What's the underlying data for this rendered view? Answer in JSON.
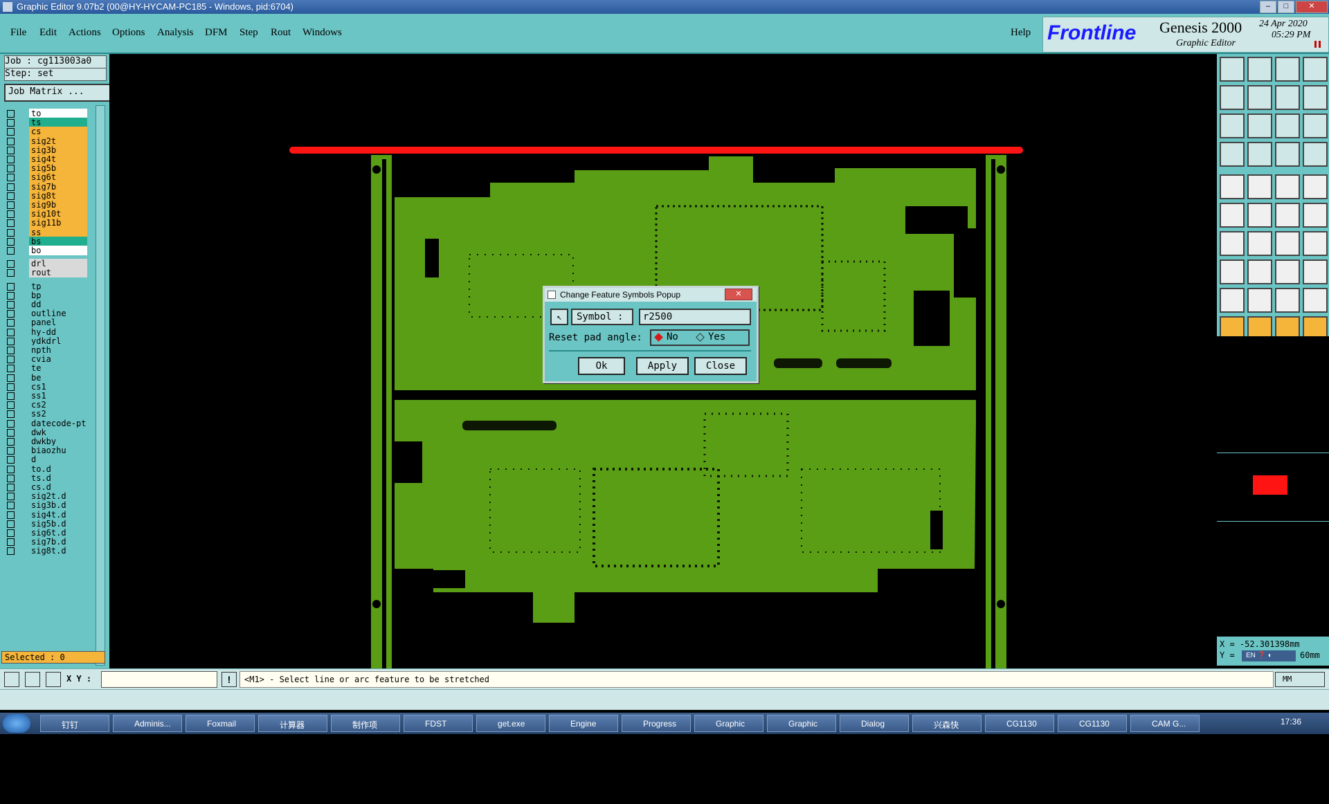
{
  "window": {
    "title": "Graphic Editor 9.07b2 (00@HY-HYCAM-PC185 - Windows, pid:6704)"
  },
  "menu": {
    "items": [
      "File",
      "Edit",
      "Actions",
      "Options",
      "Analysis",
      "DFM",
      "Step",
      "Rout",
      "Windows"
    ],
    "help": "Help"
  },
  "brand": {
    "logo": "Frontline",
    "product": "Genesis 2000",
    "subtitle": "Graphic Editor",
    "date": "24 Apr 2020",
    "time": "05:29 PM"
  },
  "job": {
    "job_label": "Job : cg113003a0",
    "step_label": "Step: set",
    "matrix_button": "Job Matrix ..."
  },
  "layers": [
    {
      "name": "to",
      "color": "#ffffff"
    },
    {
      "name": "ts",
      "color": "#1fae8e"
    },
    {
      "name": "cs",
      "color": "#f5b43a"
    },
    {
      "name": "sig2t",
      "color": "#f5b43a"
    },
    {
      "name": "sig3b",
      "color": "#f5b43a"
    },
    {
      "name": "sig4t",
      "color": "#f5b43a"
    },
    {
      "name": "sig5b",
      "color": "#f5b43a"
    },
    {
      "name": "sig6t",
      "color": "#f5b43a"
    },
    {
      "name": "sig7b",
      "color": "#f5b43a"
    },
    {
      "name": "sig8t",
      "color": "#f5b43a"
    },
    {
      "name": "sig9b",
      "color": "#f5b43a"
    },
    {
      "name": "sig10t",
      "color": "#f5b43a"
    },
    {
      "name": "sig11b",
      "color": "#f5b43a"
    },
    {
      "name": "ss",
      "color": "#f5b43a"
    },
    {
      "name": "bs",
      "color": "#1fae8e"
    },
    {
      "name": "bo",
      "color": "#ffffff"
    },
    {
      "name": "drl",
      "color": "#d9d9d9"
    },
    {
      "name": "rout",
      "color": "#d9d9d9"
    },
    {
      "name": "tp",
      "color": "#6cc5c5"
    },
    {
      "name": "bp",
      "color": "#6cc5c5"
    },
    {
      "name": "dd",
      "color": "#6cc5c5"
    },
    {
      "name": "outline",
      "color": "#6cc5c5"
    },
    {
      "name": "panel",
      "color": "#6cc5c5"
    },
    {
      "name": "hy-dd",
      "color": "#6cc5c5"
    },
    {
      "name": "ydkdrl",
      "color": "#6cc5c5"
    },
    {
      "name": "npth",
      "color": "#6cc5c5"
    },
    {
      "name": "cvia",
      "color": "#6cc5c5"
    },
    {
      "name": "te",
      "color": "#6cc5c5"
    },
    {
      "name": "be",
      "color": "#6cc5c5"
    },
    {
      "name": "cs1",
      "color": "#6cc5c5"
    },
    {
      "name": "ss1",
      "color": "#6cc5c5"
    },
    {
      "name": "cs2",
      "color": "#6cc5c5"
    },
    {
      "name": "ss2",
      "color": "#6cc5c5"
    },
    {
      "name": "datecode-pt",
      "color": "#6cc5c5"
    },
    {
      "name": "dwk",
      "color": "#6cc5c5"
    },
    {
      "name": "dwkby",
      "color": "#6cc5c5"
    },
    {
      "name": "biaozhu",
      "color": "#6cc5c5"
    },
    {
      "name": "d",
      "color": "#6cc5c5"
    },
    {
      "name": "to.d",
      "color": "#6cc5c5"
    },
    {
      "name": "ts.d",
      "color": "#6cc5c5"
    },
    {
      "name": "cs.d",
      "color": "#6cc5c5"
    },
    {
      "name": "sig2t.d",
      "color": "#6cc5c5"
    },
    {
      "name": "sig3b.d",
      "color": "#6cc5c5"
    },
    {
      "name": "sig4t.d",
      "color": "#6cc5c5"
    },
    {
      "name": "sig5b.d",
      "color": "#6cc5c5"
    },
    {
      "name": "sig6t.d",
      "color": "#6cc5c5"
    },
    {
      "name": "sig7b.d",
      "color": "#6cc5c5"
    },
    {
      "name": "sig8t.d",
      "color": "#6cc5c5"
    }
  ],
  "selected": "Selected : 0",
  "dialog": {
    "title": "Change Feature Symbols Popup",
    "symbol_label": "Symbol :",
    "symbol_value": "r2500",
    "reset_label": "Reset pad angle:",
    "opt_no": "No",
    "opt_yes": "Yes",
    "selected_option": "No",
    "ok": "Ok",
    "apply": "Apply",
    "close": "Close"
  },
  "coords": {
    "x": "X = -52.301398mm",
    "y": "Y =",
    "y_value": "60mm"
  },
  "statusbar": {
    "xy_label": "X Y :",
    "xy_value": "",
    "prompt": "<M1> - Select line or arc feature to be stretched",
    "units": "MM"
  },
  "tray": {
    "lang": "EN",
    "clock": "17:36"
  },
  "taskbar": [
    "钉钉",
    "Adminis...",
    "Foxmail",
    "计算器",
    "制作项",
    "FDST",
    "get.exe",
    "Engine",
    "Progress",
    "Graphic",
    "Graphic",
    "Dialog",
    "兴森快",
    "CG1130",
    "CG1130",
    "CAM G..."
  ],
  "colors": {
    "bg": "#000000",
    "panel": "#6cc5c5",
    "board": "#5a9e16",
    "outline": "#ff1414",
    "accent": "#1b1bff"
  }
}
